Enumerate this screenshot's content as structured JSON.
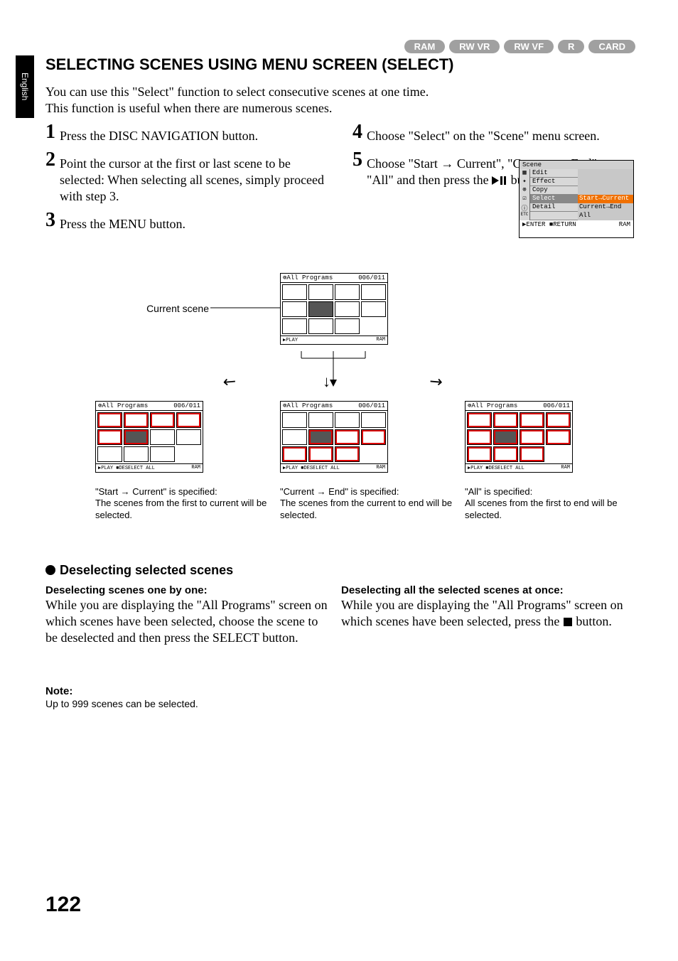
{
  "page_number": "122",
  "language_tab": "English",
  "media_pills": [
    "RAM",
    "RW VR",
    "RW VF",
    "R",
    "CARD"
  ],
  "title": "SELECTING SCENES USING MENU SCREEN (SELECT)",
  "intro_line1": "You can use this \"Select\" function to select consecutive scenes at one time.",
  "intro_line2": "This function is useful when there are numerous scenes.",
  "steps": {
    "s1": {
      "num": "1",
      "txt": "Press the DISC NAVIGATION button."
    },
    "s2": {
      "num": "2",
      "txt": "Point the cursor at the first or last scene to be selected: When selecting all scenes, simply proceed with step 3."
    },
    "s3": {
      "num": "3",
      "txt": "Press the MENU button."
    },
    "s4": {
      "num": "4",
      "txt": "Choose \"Select\" on the \"Scene\" menu screen."
    },
    "s5": {
      "num": "5",
      "txt_a": "Choose \"Start → Current\", \"Current → End\" or \"All\" and then press the ",
      "txt_b": " button."
    }
  },
  "menu_lcd": {
    "title": "Scene",
    "items": [
      {
        "label": "Edit",
        "sub": ""
      },
      {
        "label": "Effect",
        "sub": ""
      },
      {
        "label": "Copy",
        "sub": ""
      },
      {
        "label": "Select",
        "sub": "Start→Current",
        "selected": true
      },
      {
        "label": "Detail",
        "sub": "Current→End"
      },
      {
        "label": "",
        "sub": "All"
      }
    ],
    "footer_left": "ENTER",
    "footer_mid": "RETURN",
    "footer_right": "RAM"
  },
  "diagram": {
    "current_scene_label": "Current scene",
    "mini_header_left": "All Programs",
    "mini_header_right": "006/011",
    "mini_footer": {
      "top_play": "PLAY",
      "top_ram": "RAM",
      "sel_left": "PLAY",
      "sel_mid": "DESELECT ALL",
      "sel_right": "RAM"
    },
    "cap_left": "\"Start → Current\" is specified:\nThe scenes from the first to current will be selected.",
    "cap_mid": "\"Current → End\" is specified:\nThe scenes from the current to end will be selected.",
    "cap_right": "\"All\" is specified:\nAll scenes from the first to end will be selected."
  },
  "deselect_heading": "Deselecting selected scenes",
  "colL": {
    "h": "Deselecting scenes one by one:",
    "b": "While you are displaying the \"All Programs\" screen on which scenes have been selected, choose the scene to be deselected and then press the SELECT button."
  },
  "colR": {
    "h": "Deselecting all the selected scenes at once:",
    "b_a": "While you are displaying the \"All Programs\" screen on which scenes have been selected, press the ",
    "b_b": " button."
  },
  "note": {
    "h": "Note:",
    "b": "Up to 999 scenes can be selected."
  }
}
